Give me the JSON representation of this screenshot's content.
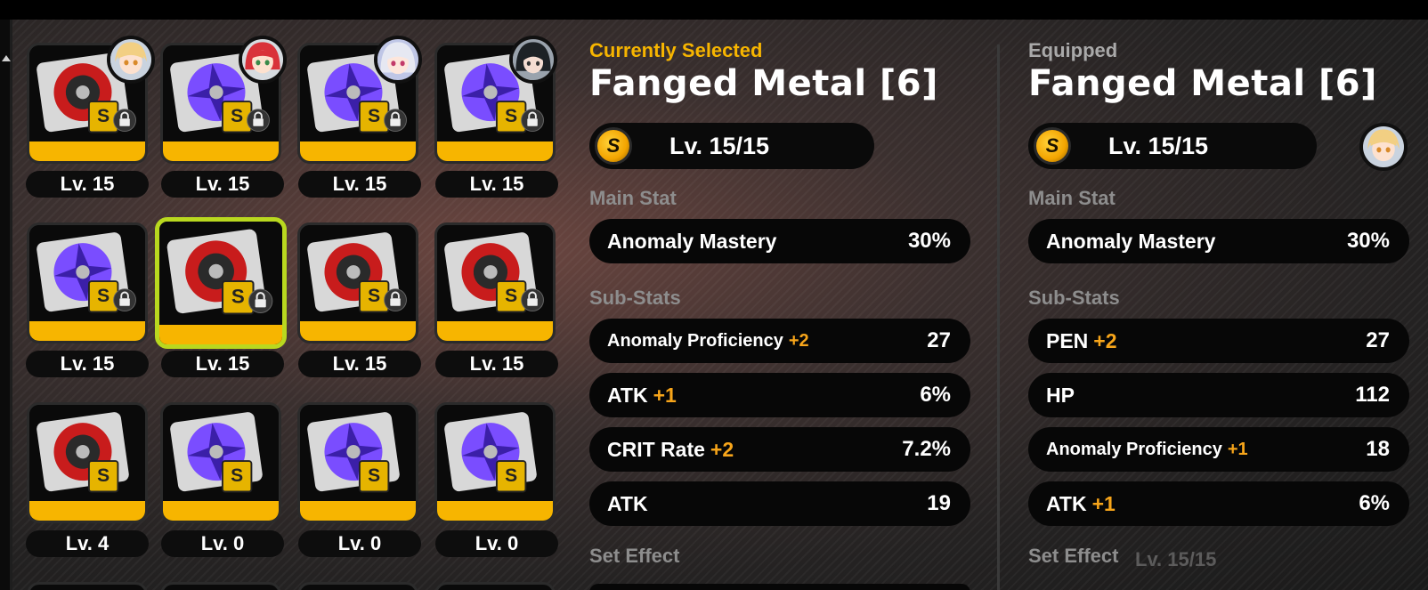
{
  "grid": {
    "discs": [
      {
        "level": "Lv. 15",
        "color": "red",
        "locked": true,
        "avatar": "blonde-agent-avatar"
      },
      {
        "level": "Lv. 15",
        "color": "purple",
        "locked": true,
        "avatar": "redhead-agent-avatar"
      },
      {
        "level": "Lv. 15",
        "color": "purple",
        "locked": true,
        "avatar": "silver-hair-agent-avatar"
      },
      {
        "level": "Lv. 15",
        "color": "purple",
        "locked": true,
        "avatar": "dark-hair-agent-avatar"
      },
      {
        "level": "Lv. 15",
        "color": "purple",
        "locked": true
      },
      {
        "level": "Lv. 15",
        "color": "red",
        "locked": true,
        "selected": true
      },
      {
        "level": "Lv. 15",
        "color": "red",
        "locked": true
      },
      {
        "level": "Lv. 15",
        "color": "red",
        "locked": true
      },
      {
        "level": "Lv. 4",
        "color": "red",
        "locked": false
      },
      {
        "level": "Lv. 0",
        "color": "purple",
        "locked": false
      },
      {
        "level": "Lv. 0",
        "color": "purple",
        "locked": false
      },
      {
        "level": "Lv. 0",
        "color": "purple",
        "locked": false
      }
    ]
  },
  "selected_panel": {
    "label": "Currently Selected",
    "title": "Fanged Metal [6]",
    "badge": "S",
    "level": "Lv. 15/15",
    "main_stat_label": "Main Stat",
    "main_stat": {
      "name": "Anomaly Mastery",
      "value": "30%"
    },
    "sub_stats_label": "Sub-Stats",
    "sub_stats": [
      {
        "name": "Anomaly Proficiency",
        "roll": "+2",
        "value": "27"
      },
      {
        "name": "ATK",
        "roll": "+1",
        "value": "6%"
      },
      {
        "name": "CRIT Rate",
        "roll": "+2",
        "value": "7.2%"
      },
      {
        "name": "ATK",
        "roll": "",
        "value": "19"
      }
    ],
    "set_effect_label": "Set Effect"
  },
  "equipped_panel": {
    "label": "Equipped",
    "title": "Fanged Metal [6]",
    "badge": "S",
    "level": "Lv. 15/15",
    "main_stat_label": "Main Stat",
    "main_stat": {
      "name": "Anomaly Mastery",
      "value": "30%"
    },
    "sub_stats_label": "Sub-Stats",
    "sub_stats": [
      {
        "name": "PEN",
        "roll": "+2",
        "value": "27"
      },
      {
        "name": "HP",
        "roll": "",
        "value": "112"
      },
      {
        "name": "Anomaly Proficiency",
        "roll": "+1",
        "value": "18"
      },
      {
        "name": "ATK",
        "roll": "+1",
        "value": "6%"
      }
    ],
    "set_effect_label": "Set Effect",
    "ghost_level": "Lv. 15/15"
  },
  "colors": {
    "accent_yellow": "#f7b500",
    "roll_orange": "#f7a51a",
    "selected_outline": "#b9d81f",
    "section_gray": "#8d8d8d",
    "disc_red": "#d42020",
    "disc_purple": "#7a4dff"
  }
}
